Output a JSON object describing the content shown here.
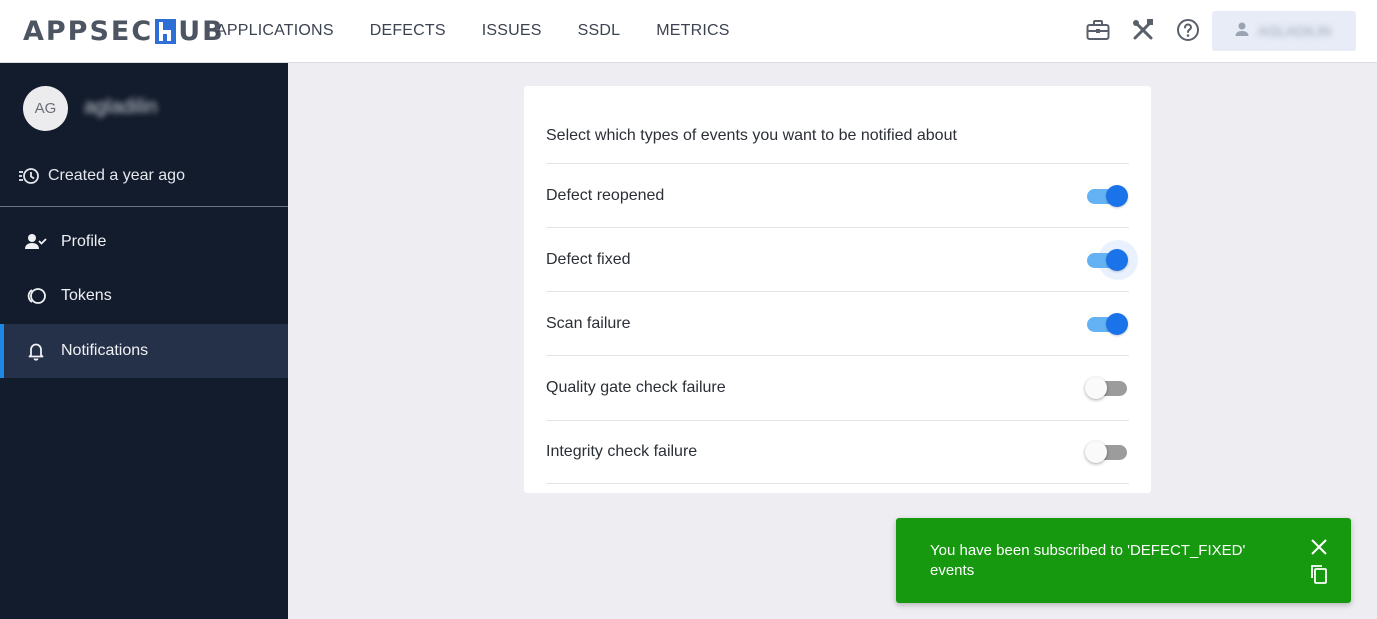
{
  "app": {
    "logo_text_left": "APPSEC",
    "logo_text_right": "UB"
  },
  "nav": {
    "items": [
      {
        "label": "APPLICATIONS"
      },
      {
        "label": "DEFECTS"
      },
      {
        "label": "ISSUES"
      },
      {
        "label": "SSDL"
      },
      {
        "label": "METRICS"
      }
    ]
  },
  "header": {
    "icons": [
      "briefcase-icon",
      "tools-icon",
      "help-icon"
    ],
    "user_label": "AGLADILIN"
  },
  "sidebar": {
    "avatar_initials": "AG",
    "username": "agladilin",
    "created": "Created a year ago",
    "items": [
      {
        "label": "Profile",
        "icon": "user-check-icon"
      },
      {
        "label": "Tokens",
        "icon": "tokens-icon"
      },
      {
        "label": "Notifications",
        "icon": "bell-icon",
        "active": true
      }
    ]
  },
  "card": {
    "title": "Select which types of events you want to be notified about",
    "rows": [
      {
        "label": "Defect reopened",
        "enabled": true
      },
      {
        "label": "Defect fixed",
        "enabled": true
      },
      {
        "label": "Scan failure",
        "enabled": true
      },
      {
        "label": "Quality gate check failure",
        "enabled": false
      },
      {
        "label": "Integrity check failure",
        "enabled": false
      }
    ]
  },
  "toast": {
    "message": "You have been subscribed to 'DEFECT_FIXED' events",
    "color": "#16980f"
  },
  "colors": {
    "accent": "#1a73e8",
    "sidebar_bg": "#131c2c",
    "toggle_track_on": "#64b2f3"
  }
}
